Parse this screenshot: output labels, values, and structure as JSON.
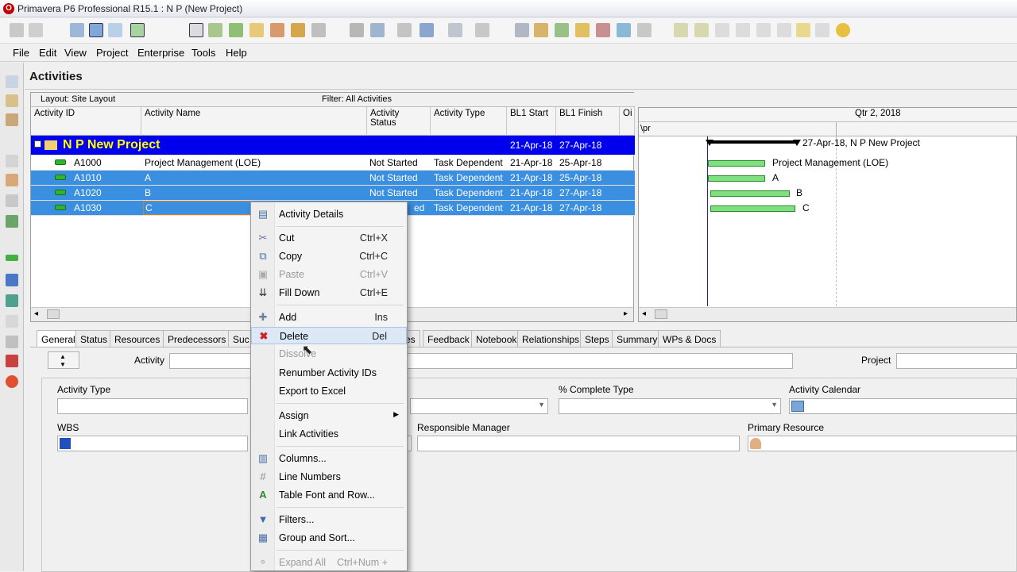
{
  "window": {
    "title": "Primavera P6 Professional R15.1 : N P (New Project)"
  },
  "menubar": [
    "File",
    "Edit",
    "View",
    "Project",
    "Enterprise",
    "Tools",
    "Help"
  ],
  "activities": {
    "heading": "Activities",
    "layout_label": "Layout: Site Layout",
    "filter_label": "Filter: All Activities",
    "columns": [
      "Activity ID",
      "Activity Name",
      "Activity Status",
      "Activity Type",
      "BL1 Start",
      "BL1 Finish",
      "Oi"
    ],
    "project_row": {
      "name": "N P  New Project",
      "bl1_start": "21-Apr-18",
      "bl1_finish": "27-Apr-18"
    },
    "rows": [
      {
        "id": "A1000",
        "name": "Project Management (LOE)",
        "status": "Not Started",
        "type": "Task Dependent",
        "bl1_start": "21-Apr-18",
        "bl1_finish": "25-Apr-18"
      },
      {
        "id": "A1010",
        "name": "A",
        "status": "Not Started",
        "type": "Task Dependent",
        "bl1_start": "21-Apr-18",
        "bl1_finish": "25-Apr-18"
      },
      {
        "id": "A1020",
        "name": "B",
        "status": "Not Started",
        "type": "Task Dependent",
        "bl1_start": "21-Apr-18",
        "bl1_finish": "27-Apr-18"
      },
      {
        "id": "A1030",
        "name": "C",
        "status": "ed",
        "type": "Task Dependent",
        "bl1_start": "21-Apr-18",
        "bl1_finish": "27-Apr-18"
      }
    ]
  },
  "gantt": {
    "header_top": "Qtr 2, 2018",
    "header_month": "\\pr",
    "project_label": "27-Apr-18, N P  New Project",
    "bar_labels": [
      "Project Management (LOE)",
      "A",
      "B",
      "C"
    ]
  },
  "tabs": [
    "General",
    "Status",
    "Resources",
    "Predecessors",
    "Suc",
    "es",
    "Feedback",
    "Notebook",
    "Relationships",
    "Steps",
    "Summary",
    "WPs & Docs"
  ],
  "detail": {
    "activity_label": "Activity",
    "project_label": "Project",
    "activity_type_label": "Activity Type",
    "pct_complete_type_label": "% Complete Type",
    "activity_calendar_label": "Activity Calendar",
    "wbs_label": "WBS",
    "responsible_manager_label": "Responsible Manager",
    "primary_resource_label": "Primary Resource"
  },
  "context_menu": {
    "items": [
      {
        "label": "Activity Details",
        "shortcut": "",
        "icon": "activity-details-icon",
        "disabled": false
      },
      {
        "label": "Cut",
        "shortcut": "Ctrl+X",
        "icon": "scissors-icon",
        "disabled": false
      },
      {
        "label": "Copy",
        "shortcut": "Ctrl+C",
        "icon": "copy-icon",
        "disabled": false
      },
      {
        "label": "Paste",
        "shortcut": "Ctrl+V",
        "icon": "paste-icon",
        "disabled": true
      },
      {
        "label": "Fill Down",
        "shortcut": "Ctrl+E",
        "icon": "fill-down-icon",
        "disabled": false
      },
      {
        "label": "Add",
        "shortcut": "Ins",
        "icon": "plus-icon",
        "disabled": false
      },
      {
        "label": "Delete",
        "shortcut": "Del",
        "icon": "delete-x-icon",
        "disabled": false
      },
      {
        "label": "Dissolve",
        "shortcut": "",
        "icon": "",
        "disabled": true
      },
      {
        "label": "Renumber Activity IDs",
        "shortcut": "",
        "icon": "",
        "disabled": false
      },
      {
        "label": "Export to Excel",
        "shortcut": "",
        "icon": "",
        "disabled": false
      },
      {
        "label": "Assign",
        "shortcut": "",
        "icon": "",
        "disabled": false
      },
      {
        "label": "Link Activities",
        "shortcut": "",
        "icon": "",
        "disabled": false
      },
      {
        "label": "Columns...",
        "shortcut": "",
        "icon": "columns-icon",
        "disabled": false
      },
      {
        "label": "Line Numbers",
        "shortcut": "",
        "icon": "hash-icon",
        "disabled": false
      },
      {
        "label": "Table Font and Row...",
        "shortcut": "",
        "icon": "table-font-icon",
        "disabled": false
      },
      {
        "label": "Filters...",
        "shortcut": "",
        "icon": "filter-icon",
        "disabled": false
      },
      {
        "label": "Group and Sort...",
        "shortcut": "",
        "icon": "group-sort-icon",
        "disabled": false
      },
      {
        "label": "Expand All",
        "shortcut": "Ctrl+Num +",
        "icon": "expand-all-icon",
        "disabled": true
      }
    ]
  },
  "colors": {
    "project_row_bg": "#0000ee",
    "project_row_text": "#ffff00",
    "selection_bg": "#3b8fe0",
    "gantt_bar": "#7ee07e"
  }
}
